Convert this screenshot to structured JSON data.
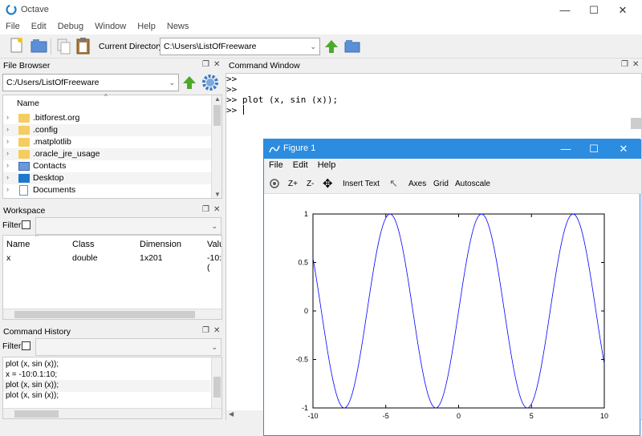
{
  "window": {
    "title": "Octave",
    "minimize_icon": "minimize-icon",
    "maximize_icon": "maximize-icon",
    "close_icon": "close-icon"
  },
  "menu": [
    "File",
    "Edit",
    "Debug",
    "Window",
    "Help",
    "News"
  ],
  "toolbar": {
    "current_directory_label": "Current Directory:",
    "current_directory": "C:\\Users\\ListOfFreeware"
  },
  "file_browser": {
    "title": "File Browser",
    "path": "C:/Users/ListOfFreeware",
    "column": "Name",
    "items": [
      {
        "name": ".bitforest.org",
        "icon": "folder-icon"
      },
      {
        "name": ".config",
        "icon": "folder-icon"
      },
      {
        "name": ".matplotlib",
        "icon": "folder-icon"
      },
      {
        "name": ".oracle_jre_usage",
        "icon": "folder-icon"
      },
      {
        "name": "Contacts",
        "icon": "contacts-icon"
      },
      {
        "name": "Desktop",
        "icon": "desktop-icon"
      },
      {
        "name": "Documents",
        "icon": "documents-icon"
      }
    ]
  },
  "workspace": {
    "title": "Workspace",
    "filter_label": "Filter",
    "columns": [
      "Name",
      "Class",
      "Dimension",
      "Valu"
    ],
    "rows": [
      {
        "name": "x",
        "class": "double",
        "dimension": "1x201",
        "value": "-10:("
      }
    ]
  },
  "command_history": {
    "title": "Command History",
    "filter_label": "Filter",
    "items": [
      "plot (x, sin (x));",
      "x = -10:0.1:10;",
      "plot (x, sin (x));",
      "plot (x, sin (x));"
    ]
  },
  "command_window": {
    "title": "Command Window",
    "lines": [
      ">>",
      ">>",
      ">> plot (x, sin (x));",
      ">>"
    ]
  },
  "figure": {
    "title": "Figure 1",
    "menu": [
      "File",
      "Edit",
      "Help"
    ],
    "tools": {
      "zoom_in": "Z+",
      "zoom_out": "Z-",
      "insert_text": "Insert Text",
      "axes": "Axes",
      "grid": "Grid",
      "autoscale": "Autoscale"
    }
  },
  "chart_data": {
    "type": "line",
    "function": "sin(x)",
    "x_range": [
      -10,
      10
    ],
    "x_step": 0.1,
    "xlim": [
      -10,
      10
    ],
    "ylim": [
      -1,
      1
    ],
    "xticks": [
      "-10",
      "-5",
      "0",
      "5",
      "10"
    ],
    "yticks": [
      "1",
      "0.5",
      "0",
      "-0.5",
      "-1"
    ],
    "series": [
      {
        "color": "#0000ff"
      }
    ],
    "grid": false
  }
}
